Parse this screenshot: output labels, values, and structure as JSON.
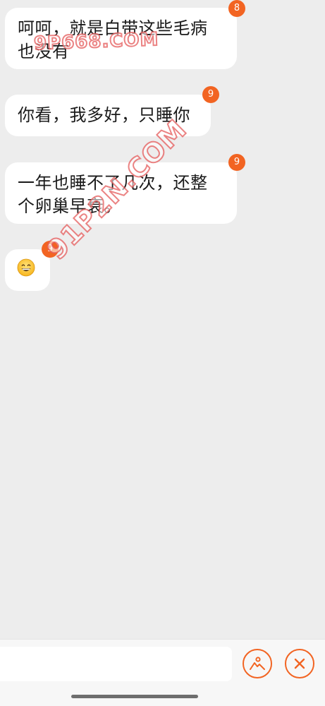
{
  "messages": [
    {
      "text": "呵呵，就是白带这些毛病\n也没有",
      "badge": "8"
    },
    {
      "text": "你看，我多好，只睡你",
      "badge": "9"
    },
    {
      "text": "一年也睡不了几次，还整\n个卵巢早衰。",
      "badge": "9"
    },
    {
      "emoji": "grinning-face-emoji",
      "badge": "9"
    }
  ],
  "watermarks": {
    "top": "9P668.COM",
    "diagonal": "91P2N.COM"
  },
  "input_bar": {
    "placeholder": "",
    "value": "",
    "image_button_icon": "image-mountain-icon",
    "close_button_icon": "close-x-icon"
  },
  "colors": {
    "accent": "#f26422",
    "background": "#ededed",
    "bubble": "#ffffff"
  }
}
